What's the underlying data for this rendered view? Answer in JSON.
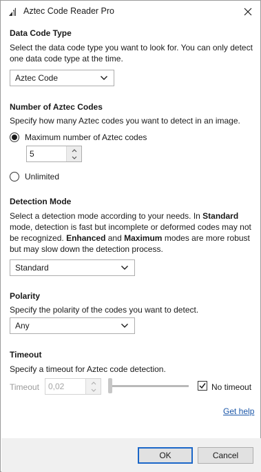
{
  "window": {
    "title": "Aztec Code Reader Pro",
    "icon": "aztec-app-icon",
    "close_icon": "close-icon"
  },
  "data_code_type": {
    "title": "Data Code Type",
    "desc_line1": "Select the data code type you want to look for. You can only detect",
    "desc_line2": "one data code type at the time.",
    "selected": "Aztec Code"
  },
  "number_of_codes": {
    "title": "Number of Aztec Codes",
    "desc": "Specify how many Aztec codes you want to detect in an image.",
    "option_max": "Maximum number of Aztec codes",
    "max_value": "5",
    "option_unlimited": "Unlimited",
    "selected_option": "maximum"
  },
  "detection_mode": {
    "title": "Detection Mode",
    "line1_a": "Select a detection mode according to your needs. In ",
    "line1_b": "Standard",
    "line2": "mode, detection is fast but incomplete or deformed codes may not",
    "line3_a": "be recognized. ",
    "line3_b": "Enhanced",
    "line3_c": " and ",
    "line3_d": "Maximum",
    "line3_e": " modes are more robust",
    "line4": "but may slow down the detection process.",
    "selected": "Standard"
  },
  "polarity": {
    "title": "Polarity",
    "desc": "Specify the polarity of the codes you want to detect.",
    "selected": "Any"
  },
  "timeout": {
    "title": "Timeout",
    "desc": "Specify a timeout for Aztec code detection.",
    "label": "Timeout",
    "value": "0,02",
    "no_timeout_label": "No timeout",
    "no_timeout_checked": true,
    "slider_fraction": 0.0
  },
  "help_link": "Get help",
  "buttons": {
    "ok": "OK",
    "cancel": "Cancel"
  },
  "colors": {
    "primary_border": "#1a66c8",
    "link": "#1a56a8",
    "footer_bg": "#f0f0f0"
  }
}
